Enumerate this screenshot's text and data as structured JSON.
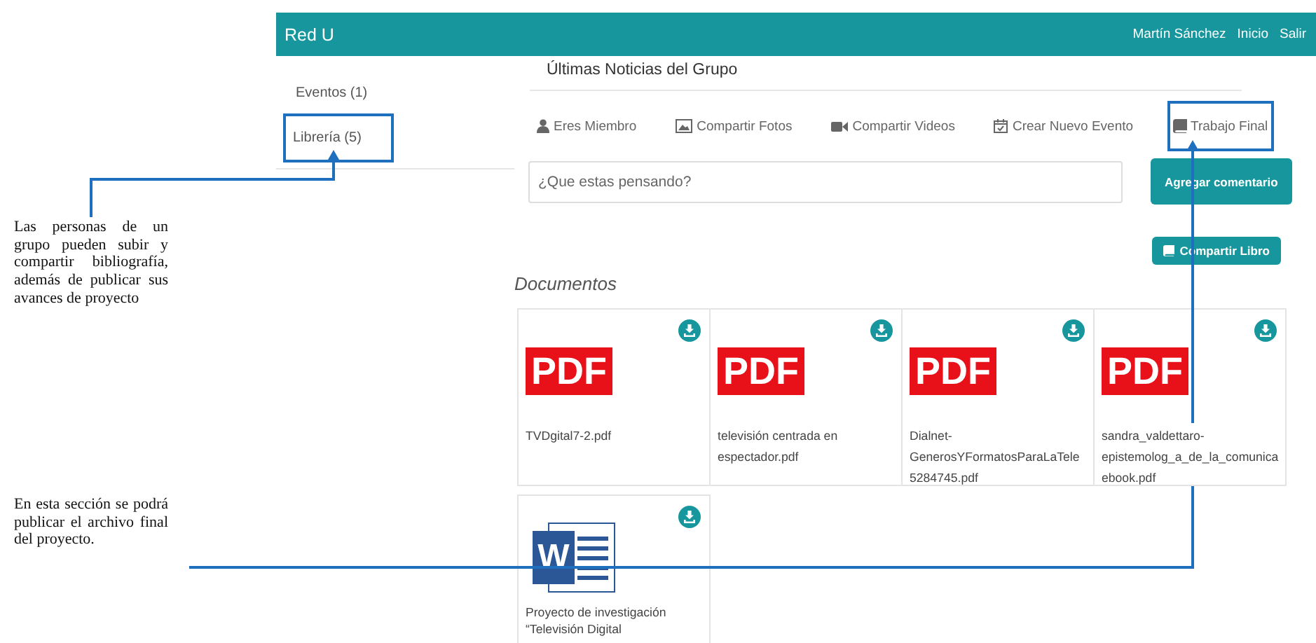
{
  "annotations": [
    {
      "text": "Las personas de un grupo pueden subir y compartir bibliografía, además de publicar sus avances de proyecto"
    },
    {
      "text": "En esta sección se podrá publicar el archivo final del proyecto."
    }
  ],
  "header": {
    "brand": "Red U",
    "links": [
      "Martín Sánchez",
      "Inicio",
      "Salir"
    ]
  },
  "sidebar": {
    "items": [
      {
        "label": "Eventos (1)",
        "highlighted": false
      },
      {
        "label": "Librería (5)",
        "highlighted": true
      }
    ]
  },
  "group": {
    "title": "Últimas Noticias del Grupo",
    "tabs": [
      {
        "kind": "user",
        "label": "Eres Miembro",
        "highlighted": false
      },
      {
        "kind": "image",
        "label": "Compartir Fotos",
        "highlighted": false
      },
      {
        "kind": "video",
        "label": "Compartir Videos",
        "highlighted": false
      },
      {
        "kind": "calendar",
        "label": "Crear Nuevo Evento",
        "highlighted": false
      },
      {
        "kind": "book",
        "label": "Trabajo Final",
        "highlighted": true
      }
    ],
    "composer": {
      "placeholder": "¿Que estas pensando?",
      "button": "Agregar comentario"
    },
    "share_button": "Compartir Libro"
  },
  "documents": {
    "title": "Documentos",
    "items": [
      {
        "kind": "pdf",
        "badge": "PDF",
        "lines": [
          "TVDgital7-2.pdf"
        ]
      },
      {
        "kind": "pdf",
        "badge": "PDF",
        "lines": [
          "televisión centrada en",
          "espectador.pdf"
        ]
      },
      {
        "kind": "pdf",
        "badge": "PDF",
        "lines": [
          "Dialnet-",
          "GenerosYFormatosParaLaTele",
          "5284745.pdf"
        ]
      },
      {
        "kind": "pdf",
        "badge": "PDF",
        "lines": [
          "sandra_valdettaro-",
          "epistemolog_a_de_la_comunica",
          "ebook.pdf"
        ]
      },
      {
        "kind": "word",
        "badge": "W",
        "lines": [
          "Proyecto de investigación",
          "“Televisión Digital"
        ]
      }
    ]
  }
}
